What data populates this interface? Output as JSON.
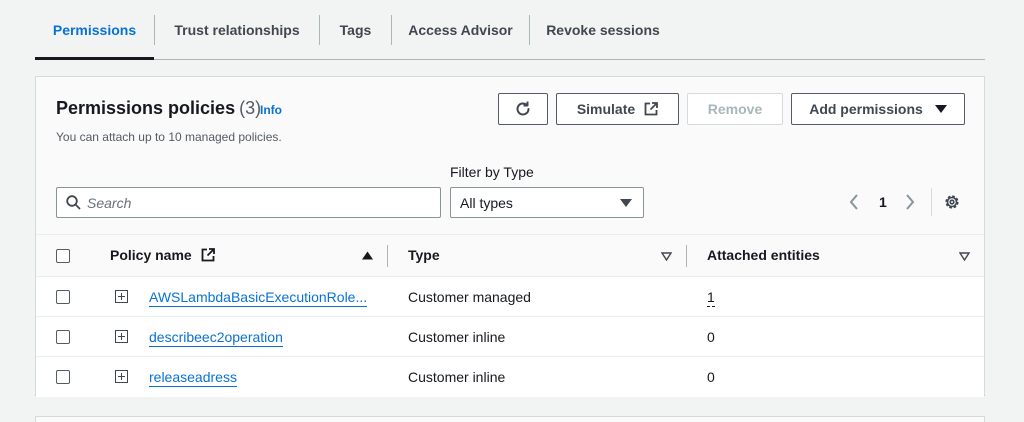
{
  "tabs": [
    {
      "label": "Permissions",
      "active": true
    },
    {
      "label": "Trust relationships"
    },
    {
      "label": "Tags"
    },
    {
      "label": "Access Advisor"
    },
    {
      "label": "Revoke sessions"
    }
  ],
  "panel": {
    "title": "Permissions policies",
    "count": "(3)",
    "info": "Info",
    "description": "You can attach up to 10 managed policies.",
    "buttons": {
      "refresh_icon": "refresh-icon",
      "simulate": "Simulate",
      "remove": "Remove",
      "add_permissions": "Add permissions"
    },
    "filter_label": "Filter by Type",
    "search_placeholder": "Search",
    "filter_value": "All types",
    "page": "1"
  },
  "table": {
    "columns": [
      "Policy name",
      "Type",
      "Attached entities"
    ],
    "rows": [
      {
        "name": "AWSLambdaBasicExecutionRole...",
        "type": "Customer managed",
        "entities": "1"
      },
      {
        "name": "describeec2operation",
        "type": "Customer inline",
        "entities": "0"
      },
      {
        "name": "releaseadress",
        "type": "Customer inline",
        "entities": "0"
      }
    ]
  },
  "colors": {
    "accent": "#0972d3",
    "text": "#16191f",
    "border": "#545b64"
  }
}
